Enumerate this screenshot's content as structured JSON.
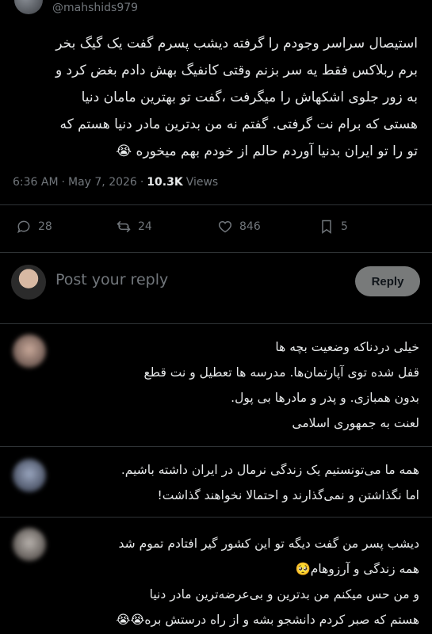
{
  "post": {
    "handle": "@mahshids979",
    "text_lines": [
      "استیصال سراسر وجودم را گرفته دیشب پسرم گفت یک گیگ بخر",
      "برم ربلاکس فقط یه سر بزنم وقتی کانفیگ بهش دادم بغض کرد و",
      "به زور جلوی اشکهاش را میگرفت ،گفت تو بهترین مامان دنیا",
      "هستی که برام نت گرفتی. گفتم نه من بدترین مادر دنیا هستم که",
      "تو را تو ایران بدنیا آوردم حالم از خودم بهم میخوره 😭"
    ],
    "time": "6:36 AM",
    "separator": "·",
    "date": "May 7, 2026",
    "views_count": "10.3K",
    "views_label": "Views"
  },
  "actions": {
    "replies": "28",
    "reposts": "24",
    "likes": "846",
    "bookmarks": "5"
  },
  "reply_box": {
    "placeholder": "Post your reply",
    "button_label": "Reply"
  },
  "replies": [
    {
      "lines": [
        "خیلی دردناکه وضعیت بچه ها",
        "قفل شده توی آپارتمان‌ها. مدرسه ها تعطیل و نت قطع",
        "بدون همبازی. و پدر و مادرها بی پول.",
        "لعنت به جمهوری اسلامی"
      ]
    },
    {
      "lines": [
        "همه ما می‌تونستیم یک زندگی نرمال در ایران داشته باشیم.",
        "اما نگذاشتن و نمی‌گذارند و احتمالا نخواهند گذاشت!"
      ]
    },
    {
      "lines": [
        "دیشب پسر من گفت دیگه تو این کشور گیر افتادم تموم شد",
        "همه زندگی و آرزوهام🥺",
        "و من حس میکنم من بدترین و بی‌عرضه‌ترین مادر دنیا",
        "هستم که صبر کردم دانشجو بشه و از راه درستش بره😭😭"
      ]
    }
  ],
  "colors": {
    "background": "#000000",
    "text": "#e7e9ea",
    "muted": "#71767b",
    "divider": "#2f3336",
    "reply_button": "#787a7a"
  }
}
